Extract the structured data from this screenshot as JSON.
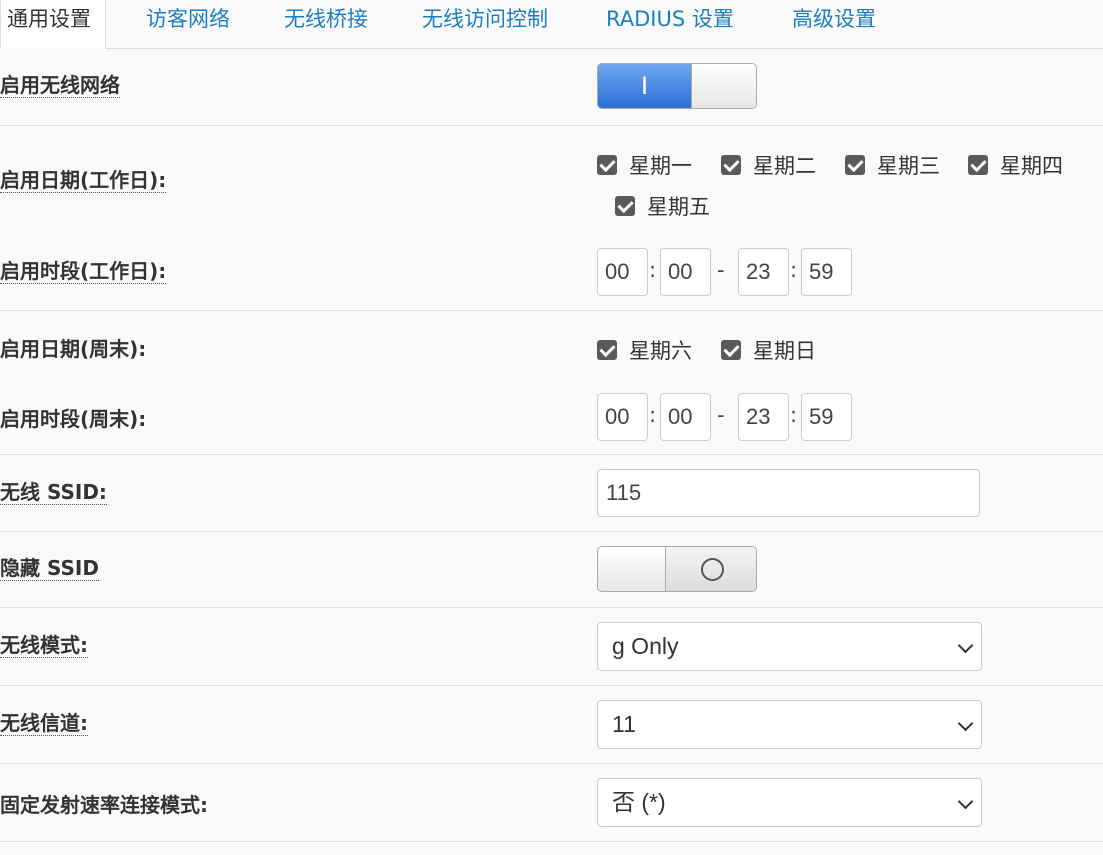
{
  "tabs": [
    {
      "label": "通用设置",
      "active": true
    },
    {
      "label": "访客网络"
    },
    {
      "label": "无线桥接"
    },
    {
      "label": "无线访问控制"
    },
    {
      "label": "RADIUS 设置"
    },
    {
      "label": "高级设置"
    }
  ],
  "enable_wireless": {
    "label": "启用无线网络",
    "on": true,
    "on_glyph": "I"
  },
  "workday_dates": {
    "label": "启用日期(工作日):",
    "days": [
      "星期一",
      "星期二",
      "星期三",
      "星期四",
      "星期五"
    ]
  },
  "workday_time": {
    "label": "启用时段(工作日):",
    "start_h": "00",
    "start_m": "00",
    "end_h": "23",
    "end_m": "59",
    "colon": ":",
    "dash": "-"
  },
  "weekend_dates": {
    "label": "启用日期(周末):",
    "days": [
      "星期六",
      "星期日"
    ]
  },
  "weekend_time": {
    "label": "启用时段(周末):",
    "start_h": "00",
    "start_m": "00",
    "end_h": "23",
    "end_m": "59",
    "colon": ":",
    "dash": "-"
  },
  "ssid": {
    "label": "无线 SSID:",
    "value": "115"
  },
  "hide_ssid": {
    "label": "隐藏 SSID",
    "on": false
  },
  "wireless_mode": {
    "label": "无线模式:",
    "value": "g Only"
  },
  "channel": {
    "label": "无线信道:",
    "value": "11"
  },
  "fixed_rate": {
    "label": "固定发射速率连接模式:",
    "value": "否 (*)"
  },
  "colors": {
    "accent": "#1a7fc1",
    "switch_on": "#2a6fd6",
    "checkbox": "#5a5a5a"
  }
}
